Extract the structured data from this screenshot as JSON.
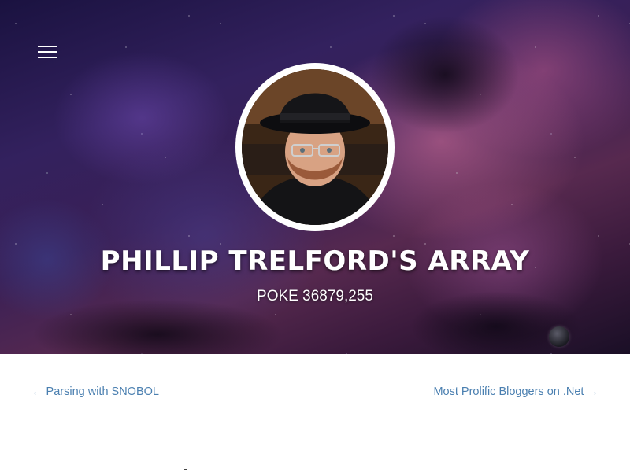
{
  "header": {
    "menu_icon": "hamburger-menu-icon",
    "avatar_alt": "Author photo",
    "title": "PHILLIP TRELFORD'S ARRAY",
    "subtitle": "POKE 36879,255"
  },
  "post_nav": {
    "previous_label": "← Parsing with SNOBOL",
    "next_label": "Most Prolific Bloggers on .Net →"
  },
  "colors": {
    "link": "#4a7fb0",
    "title_text": "#ffffff",
    "divider": "#c9c9c9"
  }
}
